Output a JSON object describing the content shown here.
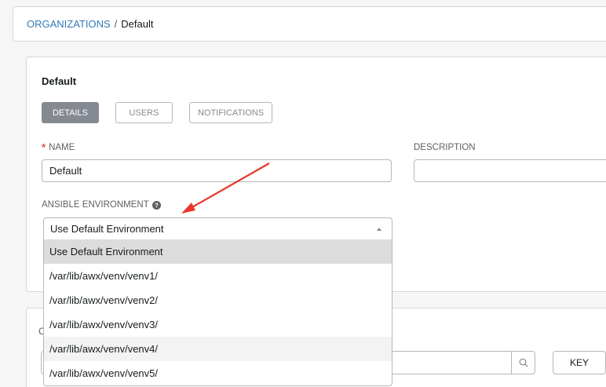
{
  "breadcrumb": {
    "parent": "ORGANIZATIONS",
    "separator": "/",
    "current": "Default"
  },
  "form": {
    "title": "Default",
    "tabs": [
      {
        "label": "DETAILS",
        "active": true
      },
      {
        "label": "USERS",
        "active": false
      },
      {
        "label": "NOTIFICATIONS",
        "active": false
      }
    ],
    "name_label": "NAME",
    "name_required_marker": "*",
    "name_value": "Default",
    "description_label": "DESCRIPTION",
    "description_value": "",
    "environment_label": "ANSIBLE ENVIRONMENT",
    "environment_selected": "Use Default Environment",
    "environment_options": [
      "Use Default Environment",
      "/var/lib/awx/venv/venv1/",
      "/var/lib/awx/venv/venv2/",
      "/var/lib/awx/venv/venv3/",
      "/var/lib/awx/venv/venv4/",
      "/var/lib/awx/venv/venv5/"
    ]
  },
  "lower_panel": {
    "label": "C",
    "key_button": "KEY"
  },
  "icons": {
    "help": "question-circle-icon",
    "search": "search-icon",
    "caret": "caret-up-icon"
  },
  "colors": {
    "link": "#337ab7",
    "tab_active": "#848992",
    "required": "#d9534f",
    "arrow": "#e8372b",
    "option_selected": "#dcdcdc"
  }
}
